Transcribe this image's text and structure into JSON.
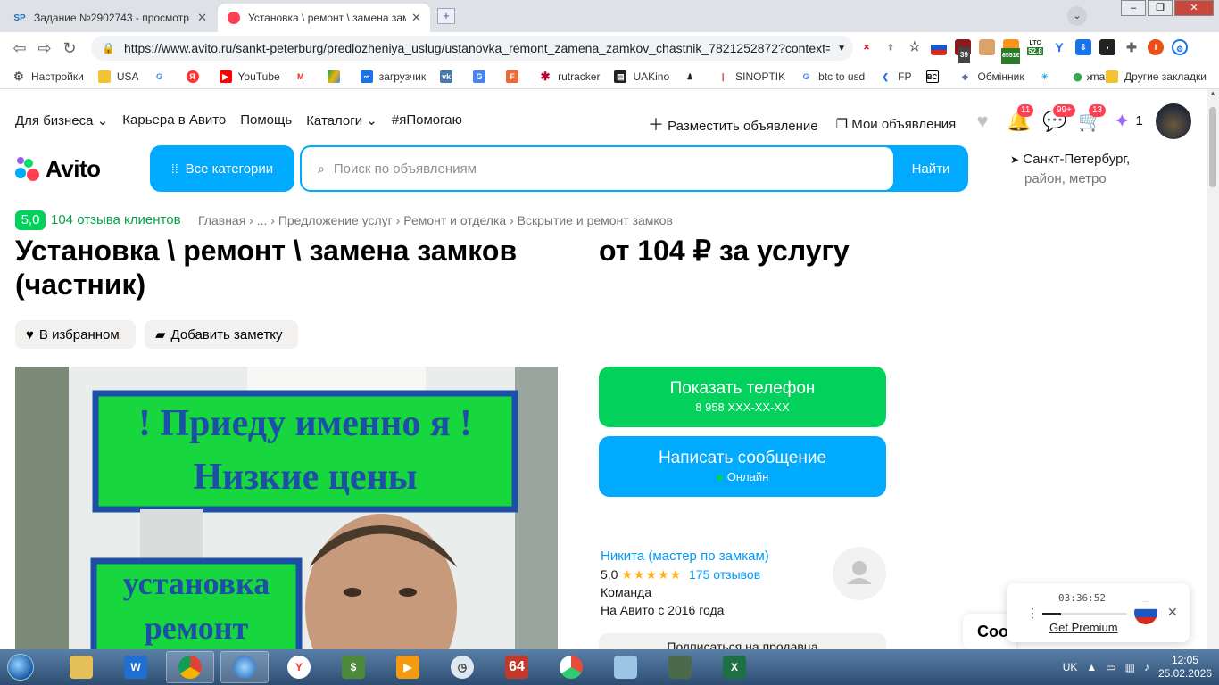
{
  "browser": {
    "tabs": [
      {
        "title": "Задание №2902743 - просмотр з",
        "icon": "SP"
      },
      {
        "title": "Установка \\ ремонт \\ замена зам",
        "icon": "avito"
      }
    ],
    "url": "https://www.avito.ru/sankt-peterburg/predlozheniya_uslug/ustanovka_remont_zamena_zamkov_chastnik_7821252872?context=H...",
    "ext_badges": {
      "mail": "39",
      "btc": "6551€",
      "ltc_label": "LTC",
      "ltc": "52.8"
    },
    "bookmarks": [
      "Настройки",
      "USA",
      "",
      "",
      "YouTube",
      "",
      "",
      "загрузчик",
      "",
      "",
      "",
      "rutracker",
      "UAKino",
      "",
      "SINOPTIK",
      "btc to usd",
      "FP",
      "",
      "Обмінник",
      "",
      "maps"
    ],
    "bookmarks_more": "»",
    "other_bookmarks": "Другие закладки"
  },
  "site": {
    "nav": [
      "Для бизнеса",
      "Карьера в Авито",
      "Помощь",
      "Каталоги",
      "#яПомогаю"
    ],
    "post_ad": "Разместить объявление",
    "my_ads": "Мои объявления",
    "badges": {
      "notifications": "11",
      "messages": "99+",
      "cart": "13",
      "coins": "1"
    },
    "logo": "Avito",
    "all_categories": "Все категории",
    "search_placeholder": "Поиск по объявлениям",
    "search_button": "Найти",
    "city": "Санкт-Петербург,",
    "city_sub": "район, метро"
  },
  "listing": {
    "rating": "5,0",
    "reviews": "104 отзыва клиентов",
    "breadcrumbs": "Главная › ... › Предложение услуг › Ремонт и отделка › Вскрытие и ремонт замков",
    "title": "Установка \\ ремонт \\ замена замков (частник)",
    "price": "от 104 ₽ за услугу",
    "fav_button": "В избранном",
    "note_button": "Добавить заметку",
    "photo_text_1": "! Приеду именно я !",
    "photo_text_2": "Низкие цены",
    "photo_text_3": "установка",
    "photo_text_4": "ремонт",
    "show_phone": "Показать телефон",
    "phone_masked": "8 958 XXX-XX-XX",
    "write_message": "Написать сообщение",
    "online": "Онлайн",
    "seller_name": "Никита (мастер по замкам)",
    "seller_rating": "5,0",
    "seller_stars": "★★★★★",
    "seller_reviews": "175 отзывов",
    "seller_type": "Команда",
    "seller_since": "На Авито с 2016 года",
    "subscribe": "Подписаться на продавца",
    "chat_text": "Coo"
  },
  "player": {
    "time": "03:36:52",
    "premium": "Get Premium",
    "progress": 0.22
  },
  "taskbar": {
    "lang": "UK",
    "time": "12:05",
    "date": "25.02.2026",
    "app_64": "64"
  }
}
